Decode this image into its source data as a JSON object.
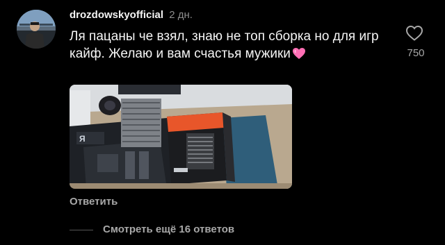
{
  "comment": {
    "username": "drozdowskyofficial",
    "time": "2 дн.",
    "text": "Ля пацаны че взял, знаю не топ сборка но для игр кайф. Желаю и вам счастья мужики",
    "emoji": "pink-heart",
    "like_count": "750",
    "reply_label": "Ответить",
    "view_replies_label": "Смотреть ещё 16 ответов",
    "photo_description_icon": "photo-pc-build"
  },
  "colors": {
    "background": "#000000",
    "text_primary": "#f5f5f5",
    "text_secondary": "#a8a8a8",
    "heart_emoji": "#ff6fb5"
  }
}
